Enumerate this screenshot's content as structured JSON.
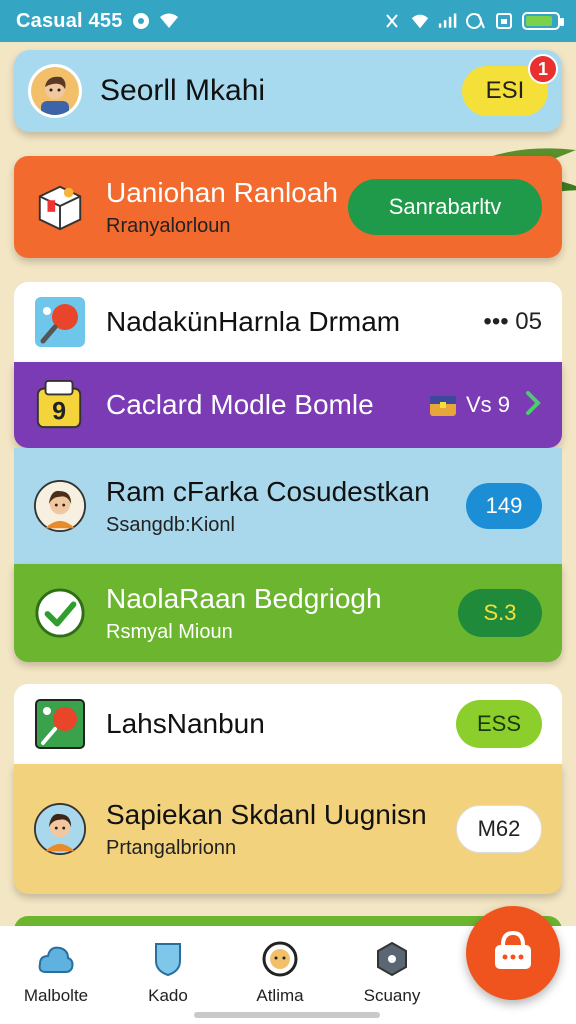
{
  "status_bar": {
    "time": "Casual 455",
    "battery_level": 0.85
  },
  "header": {
    "name": "Seorll Mkahi",
    "badge_label": "ESI",
    "notification_count": "1"
  },
  "rows": [
    {
      "title": "Uaniohan Ranloah",
      "subtitle": "Rranyalorloun",
      "button": "Sanrabarltv",
      "icon": "package-icon"
    },
    {
      "title": "NadakünHarnla Drmam",
      "subtitle": "",
      "button": "••• 05",
      "icon": "ping-pong-icon"
    },
    {
      "title": "Caclard Modle Bomle",
      "subtitle": "",
      "button": "Vs 9",
      "icon": "game-card-icon"
    },
    {
      "title": "Ram cFarka Cosudestkan",
      "subtitle": "Ssangdb:Kionl",
      "button": "149",
      "icon": "avatar"
    },
    {
      "title": "NaolaRaan Bedgriogh",
      "subtitle": "Rsmyal Mioun",
      "button": "S.3",
      "icon": "check-icon"
    },
    {
      "title": "LahsNanbun",
      "subtitle": "",
      "button": "ESS",
      "icon": "ping-pong-icon"
    },
    {
      "title": "Sapiekan Skdanl Uugnisn",
      "subtitle": "Prtangalbrionn",
      "button": "M62",
      "icon": "avatar"
    }
  ],
  "bottom_nav": [
    {
      "label": "Malbolte",
      "icon": "cloud-icon"
    },
    {
      "label": "Kado",
      "icon": "shield-icon"
    },
    {
      "label": "Atlima",
      "icon": "face-badge-icon"
    },
    {
      "label": "Scuany",
      "icon": "hexagon-icon"
    }
  ],
  "fab": {
    "icon": "basket-icon"
  },
  "colors": {
    "status_bar": "#34a6c4",
    "header": "#a7daee",
    "orange": "#f26a2e",
    "purple": "#7a3bb4",
    "blue_light": "#a9d8ec",
    "green": "#6cb52f",
    "yellow_light": "#f3d27d",
    "button_green": "#1f9a4a",
    "button_blue": "#1c8ed6",
    "fab": "#f0541e"
  }
}
